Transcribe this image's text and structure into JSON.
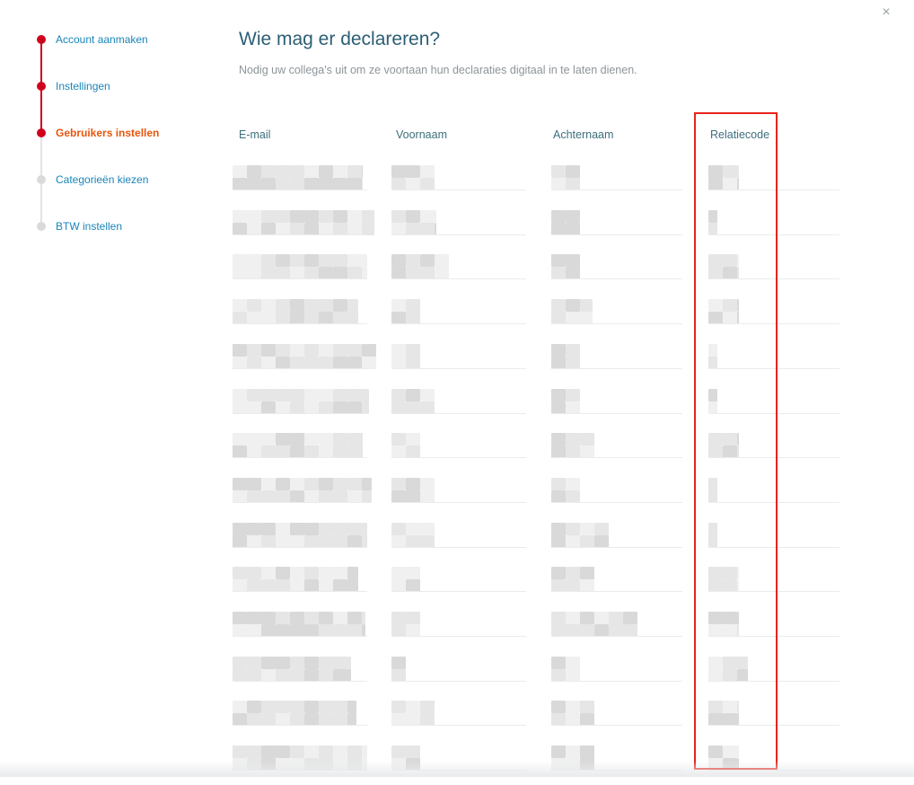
{
  "dialog": {
    "close_symbol": "×"
  },
  "stepper": {
    "steps": [
      {
        "label": "Account aanmaken",
        "state": "done"
      },
      {
        "label": "Instellingen",
        "state": "done"
      },
      {
        "label": "Gebruikers instellen",
        "state": "current"
      },
      {
        "label": "Categorieën kiezen",
        "state": "todo"
      },
      {
        "label": "BTW instellen",
        "state": "todo"
      }
    ]
  },
  "header": {
    "title": "Wie mag er declareren?",
    "subtitle": "Nodig uw collega's uit om ze voortaan hun declaraties digitaal in te laten dienen."
  },
  "table": {
    "columns": [
      "E-mail",
      "Voornaam",
      "Achternaam",
      "Relatiecode"
    ],
    "row_count": 14,
    "cell_content": "pixelated (redacted)"
  },
  "colors": {
    "accent_red": "#d0021b",
    "current_step": "#e8550c",
    "link_blue": "#1a85b8",
    "title": "#2c5e75",
    "highlight_border": "#e8231a"
  }
}
